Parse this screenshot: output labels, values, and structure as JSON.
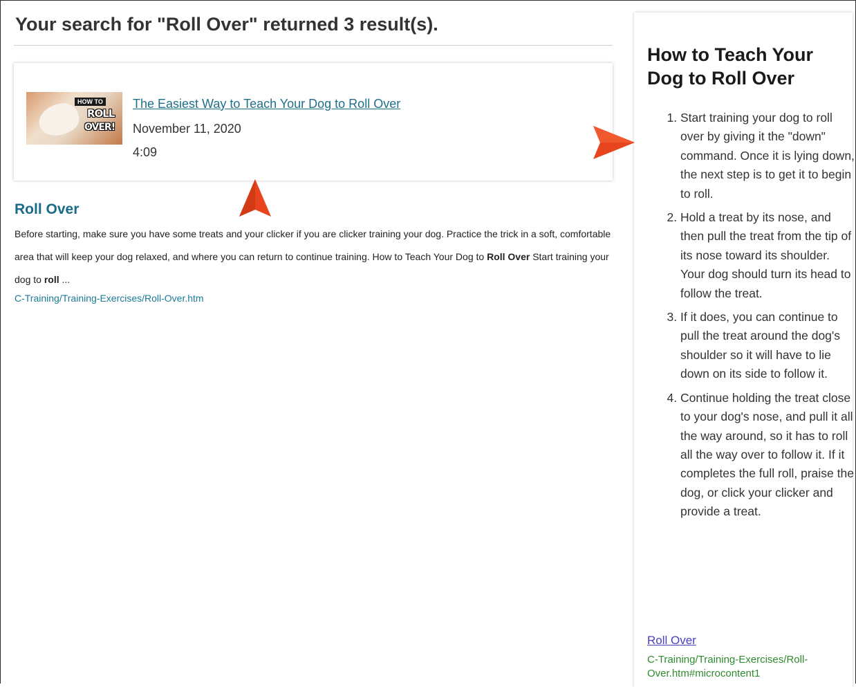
{
  "results": {
    "heading": "Your search for \"Roll Over\" returned 3 result(s).",
    "video": {
      "thumbnail_text_top": "HOW TO",
      "thumbnail_text_mid": "ROLL",
      "thumbnail_text_bottom": "OVER!",
      "title": "The Easiest Way to Teach Your Dog to Roll Over",
      "date": "November 11, 2020",
      "duration": "4:09"
    },
    "topic": {
      "title": "Roll Over",
      "snippet_part1": "Before starting, make sure you have some treats and your clicker if you are clicker training your dog. Practice the trick in a soft, comfortable area that will keep your dog relaxed, and where you can return to continue training. How to Teach Your Dog to ",
      "snippet_bold1": "Roll Over",
      "snippet_part2": " Start training your dog to ",
      "snippet_bold2": "roll",
      "snippet_part3": " ...",
      "url": "C-Training/Training-Exercises/Roll-Over.htm"
    }
  },
  "panel": {
    "title": "How to Teach Your Dog to Roll Over",
    "steps": [
      "Start training your dog to roll over by giving it the \"down\" command. Once it is lying down, the next step is to get it to begin to roll.",
      "Hold a treat by its nose, and then pull the treat from the tip of its nose toward its shoulder. Your dog should turn its head to follow the treat.",
      "If it does, you can continue to pull the treat around the dog's shoulder so it will have to lie down on its side to follow it.",
      "Continue holding the treat close to your dog's nose, and pull it all the way around, so it has to roll all the way over to follow it. If it completes the full roll, praise the dog, or click your clicker and provide a treat."
    ],
    "link": "Roll Over",
    "url": "C-Training/Training-Exercises/Roll-Over.htm#microcontent1"
  },
  "colors": {
    "callout_arrow": "#e8451e",
    "link_blue": "#1f6f8b",
    "panel_link": "#4a3fc2",
    "panel_url_green": "#2f8a2f"
  },
  "icons": {
    "callout_up": "arrow-up-icon",
    "callout_right": "arrow-right-icon"
  }
}
